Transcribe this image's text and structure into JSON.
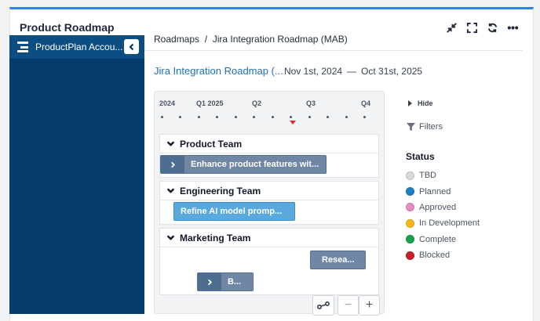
{
  "widget": {
    "title": "Product Roadmap",
    "tools": [
      "collapse-arrows-icon",
      "fullscreen-icon",
      "refresh-icon",
      "more-icon"
    ]
  },
  "sidebar": {
    "account_label": "ProductPlan Accou..."
  },
  "breadcrumb": "Roadmaps  /  Jira Integration Roadmap (MAB)",
  "roadmap": {
    "title": "Jira Integration Roadmap (...",
    "start": "Nov 1st, 2024",
    "separator": "—",
    "end": "Oct 31st, 2025"
  },
  "timeline": {
    "ticks": [
      "2024",
      "Q1 2025",
      "Q2",
      "Q3",
      "Q4"
    ],
    "lanes": [
      {
        "name": "Product Team",
        "bars": [
          {
            "label": "Enhance product features wit...",
            "status": "TBD-gray",
            "has_children": true
          }
        ]
      },
      {
        "name": "Engineering Team",
        "bars": [
          {
            "label": "Refine AI model promp...",
            "status": "Planned",
            "has_children": false
          }
        ]
      },
      {
        "name": "Marketing Team",
        "bars": [
          {
            "label": "Resea...",
            "status": "TBD-gray",
            "has_children": false
          },
          {
            "label": "B...",
            "status": "TBD-gray",
            "has_children": true
          }
        ]
      }
    ],
    "zoom_minus": "−",
    "zoom_plus": "+"
  },
  "legend": {
    "hide_label": "Hide",
    "filters_label": "Filters",
    "status_title": "Status",
    "items": [
      {
        "label": "TBD",
        "color": "#d9d9d9"
      },
      {
        "label": "Planned",
        "color": "#1f7fc8"
      },
      {
        "label": "Approved",
        "color": "#e58cc4"
      },
      {
        "label": "In Development",
        "color": "#f5b818"
      },
      {
        "label": "Complete",
        "color": "#17a34a"
      },
      {
        "label": "Blocked",
        "color": "#c8202a"
      }
    ]
  }
}
